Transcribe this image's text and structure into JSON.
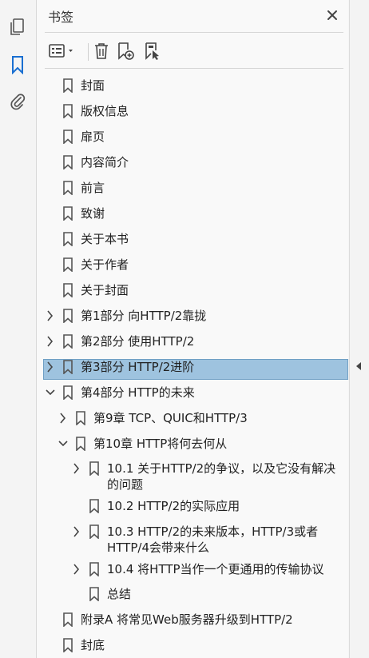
{
  "panel": {
    "title": "书签"
  },
  "icons": {
    "pages": "pages-icon",
    "bookmarks": "bookmark-ribbon-icon",
    "attachments": "paperclip-icon",
    "close": "close-icon",
    "options": "options-menu-icon",
    "delete": "trash-icon",
    "new_bookmark": "add-bookmark-icon",
    "bookmark_from_selection": "bookmark-cursor-icon"
  },
  "colors": {
    "accent": "#1a6fd1",
    "selected": "#9ec3df",
    "icon": "#555555"
  },
  "tree": [
    {
      "label": "封面"
    },
    {
      "label": "版权信息"
    },
    {
      "label": "扉页"
    },
    {
      "label": "内容简介"
    },
    {
      "label": "前言"
    },
    {
      "label": "致谢"
    },
    {
      "label": "关于本书"
    },
    {
      "label": "关于作者"
    },
    {
      "label": "关于封面"
    },
    {
      "label": "第1部分 向HTTP/2靠拢"
    },
    {
      "label": "第2部分 使用HTTP/2"
    },
    {
      "label": "第3部分 HTTP/2进阶"
    },
    {
      "label": "第4部分 HTTP的未来"
    },
    {
      "label": "第9章 TCP、QUIC和HTTP/3"
    },
    {
      "label": "第10章 HTTP将何去何从"
    },
    {
      "label": "10.1 关于HTTP/2的争议，以及它没有解决的问题"
    },
    {
      "label": "10.2 HTTP/2的实际应用"
    },
    {
      "label": "10.3 HTTP/2的未来版本，HTTP/3或者HTTP/4会带来什么"
    },
    {
      "label": "10.4 将HTTP当作一个更通用的传输协议"
    },
    {
      "label": "总结"
    },
    {
      "label": "附录A 将常见Web服务器升级到HTTP/2"
    },
    {
      "label": "封底"
    }
  ]
}
